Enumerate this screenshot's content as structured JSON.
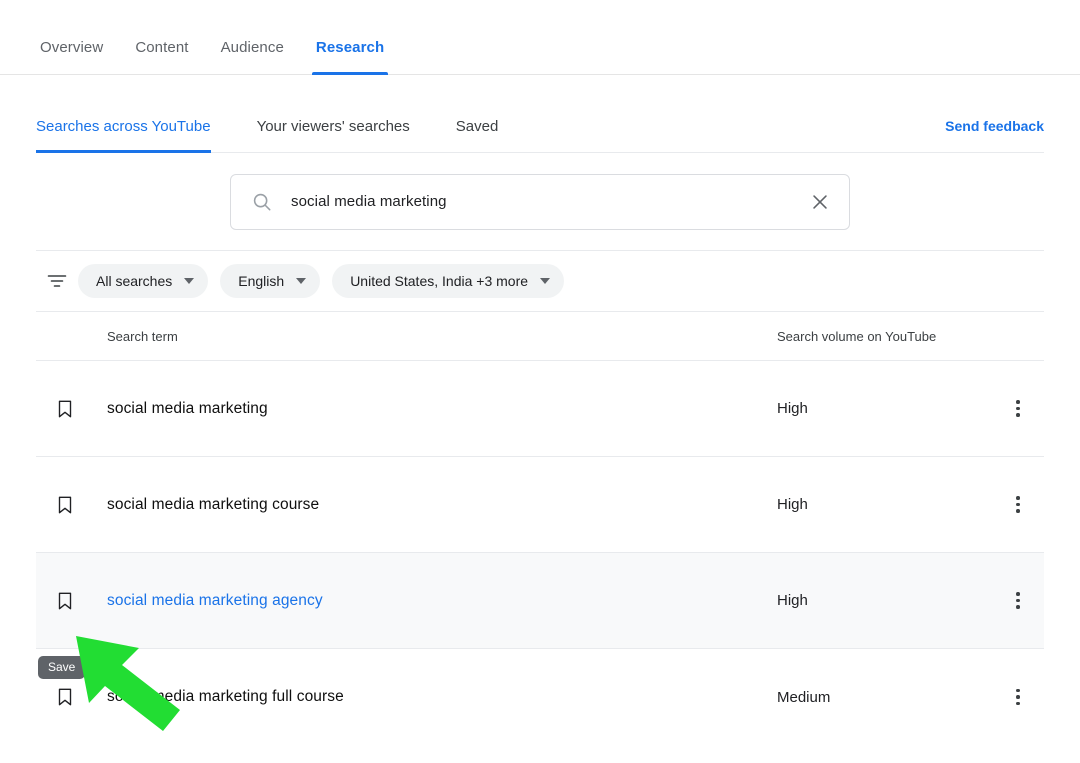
{
  "top_nav": {
    "items": [
      {
        "label": "Overview",
        "active": false
      },
      {
        "label": "Content",
        "active": false
      },
      {
        "label": "Audience",
        "active": false
      },
      {
        "label": "Research",
        "active": true
      }
    ]
  },
  "sub_tabs": {
    "items": [
      {
        "label": "Searches across YouTube",
        "active": true
      },
      {
        "label": "Your viewers' searches",
        "active": false
      },
      {
        "label": "Saved",
        "active": false
      }
    ],
    "send_feedback_label": "Send feedback"
  },
  "search": {
    "value": "social media marketing",
    "placeholder": "Search",
    "search_icon": "search-icon",
    "clear_icon": "close-icon"
  },
  "filters": {
    "filter_icon": "filter-tune-icon",
    "chips": [
      {
        "label": "All searches"
      },
      {
        "label": "English"
      },
      {
        "label": "United States, India +3 more"
      }
    ]
  },
  "table": {
    "headers": {
      "term": "Search term",
      "volume": "Search volume on YouTube"
    },
    "rows": [
      {
        "term": "social media marketing",
        "volume": "High",
        "highlight": false,
        "link": false
      },
      {
        "term": "social media marketing course",
        "volume": "High",
        "highlight": false,
        "link": false
      },
      {
        "term": "social media marketing agency",
        "volume": "High",
        "highlight": true,
        "link": true
      },
      {
        "term": "social media marketing full course",
        "volume": "Medium",
        "highlight": false,
        "link": false
      }
    ]
  },
  "tooltip": {
    "label": "Save"
  },
  "annotation": {
    "arrow_color": "#22dd33",
    "arrow_name": "green-pointer-arrow"
  },
  "colors": {
    "accent_blue": "#1a73e8",
    "row_highlight": "#f8f9fa",
    "chip_bg": "#f1f3f4",
    "tooltip_bg": "#5f6368"
  }
}
